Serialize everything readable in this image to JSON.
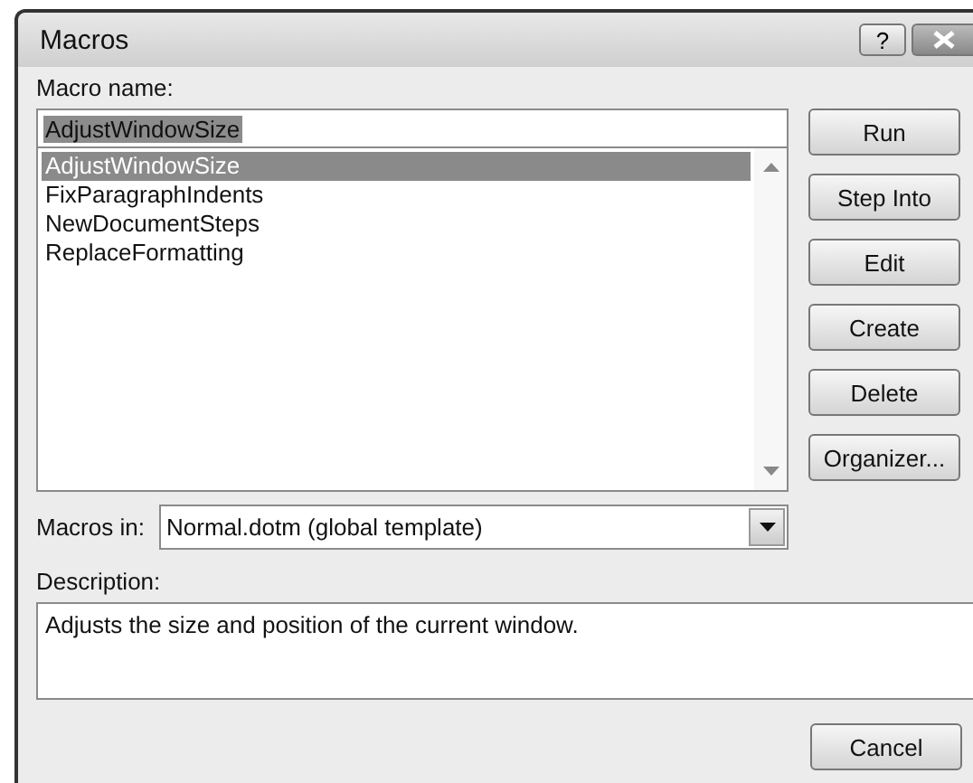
{
  "window": {
    "title": "Macros",
    "help_button": "?"
  },
  "macro_name": {
    "label": "Macro name:",
    "value": "AdjustWindowSize"
  },
  "macros": [
    {
      "name": "AdjustWindowSize",
      "selected": true
    },
    {
      "name": "FixParagraphIndents",
      "selected": false
    },
    {
      "name": "NewDocumentSteps",
      "selected": false
    },
    {
      "name": "ReplaceFormatting",
      "selected": false
    }
  ],
  "buttons": [
    "Run",
    "Step Into",
    "Edit",
    "Create",
    "Delete",
    "Organizer..."
  ],
  "macros_in": {
    "label": "Macros in:",
    "value": "Normal.dotm (global template)"
  },
  "description": {
    "label": "Description:",
    "value": "Adjusts the size and position of the current window."
  },
  "cancel_button": "Cancel"
}
